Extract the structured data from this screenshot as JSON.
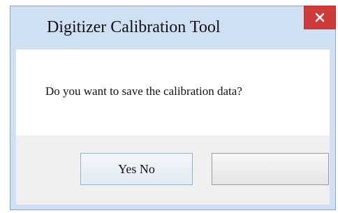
{
  "dialog": {
    "title": "Digitizer Calibration Tool",
    "message": "Do you want to save the calibration data?",
    "buttons": {
      "primary_label": "Yes No",
      "secondary_label": ""
    },
    "icons": {
      "close": "close-icon"
    }
  },
  "colors": {
    "titlebar_bg": "#cfe0f3",
    "close_button_bg": "#cf3a3a",
    "content_bg": "#ffffff",
    "footer_bg": "#f0f0f0",
    "primary_button_border": "#8fb2d8"
  }
}
